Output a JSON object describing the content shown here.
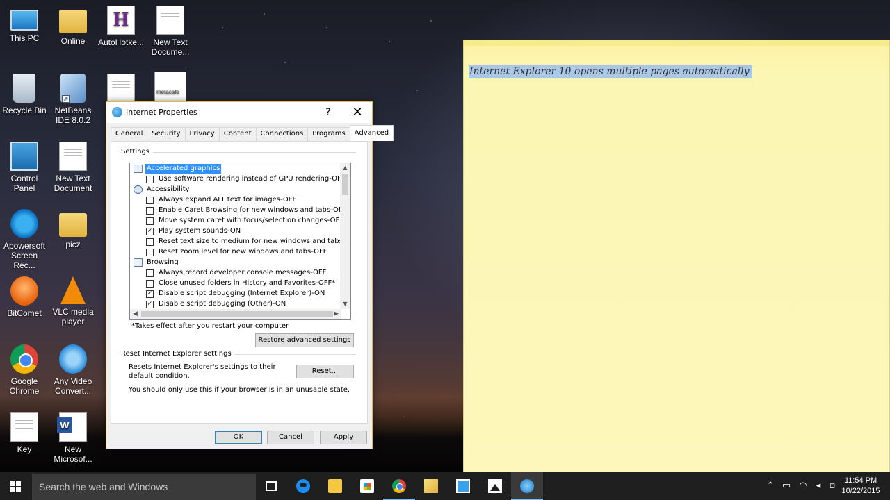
{
  "desktop": {
    "icons": [
      {
        "label": "This PC"
      },
      {
        "label": "Online"
      },
      {
        "label": "AutoHotke..."
      },
      {
        "label": "New Text Docume..."
      },
      {
        "label": "Recycle Bin"
      },
      {
        "label": "NetBeans IDE 8.0.2"
      },
      {
        "label": "Control Panel"
      },
      {
        "label": "New Text Document"
      },
      {
        "label": "Apowersoft Screen Rec..."
      },
      {
        "label": "picz"
      },
      {
        "label": "BitComet"
      },
      {
        "label": "VLC media player"
      },
      {
        "label": "Google Chrome"
      },
      {
        "label": "Any Video Convert..."
      },
      {
        "label": "Key"
      },
      {
        "label": "New Microsof..."
      }
    ],
    "partial_icon_text": "metacafe"
  },
  "sticky_note": {
    "text": "Internet Explorer 10 opens multiple pages automatically"
  },
  "dialog": {
    "title": "Internet Properties",
    "help_label": "?",
    "close_label": "✕",
    "tabs": [
      "General",
      "Security",
      "Privacy",
      "Content",
      "Connections",
      "Programs",
      "Advanced"
    ],
    "active_tab": "Advanced",
    "settings_label": "Settings",
    "tree": [
      {
        "type": "category",
        "text": "Accelerated graphics",
        "selected": true
      },
      {
        "type": "option",
        "text": "Use software rendering instead of GPU rendering-OFF*",
        "checked": false
      },
      {
        "type": "category",
        "text": "Accessibility",
        "selected": false
      },
      {
        "type": "option",
        "text": "Always expand ALT text for images-OFF",
        "checked": false
      },
      {
        "type": "option",
        "text": "Enable Caret Browsing for new windows and tabs-OFF",
        "checked": false
      },
      {
        "type": "option",
        "text": "Move system caret with focus/selection changes-OFF",
        "checked": false
      },
      {
        "type": "option",
        "text": "Play system sounds-ON",
        "checked": true
      },
      {
        "type": "option",
        "text": "Reset text size to medium for new windows and tabs-OFF",
        "checked": false
      },
      {
        "type": "option",
        "text": "Reset zoom level for new windows and tabs-OFF",
        "checked": false
      },
      {
        "type": "category",
        "text": "Browsing",
        "selected": false
      },
      {
        "type": "option",
        "text": "Always record developer console messages-OFF",
        "checked": false
      },
      {
        "type": "option",
        "text": "Close unused folders in History and Favorites-OFF*",
        "checked": false
      },
      {
        "type": "option",
        "text": "Disable script debugging (Internet Explorer)-ON",
        "checked": true
      },
      {
        "type": "option",
        "text": "Disable script debugging (Other)-ON",
        "checked": true
      }
    ],
    "restart_note": "*Takes effect after you restart your computer",
    "restore_button": "Restore advanced settings",
    "reset_group_label": "Reset Internet Explorer settings",
    "reset_description": "Resets Internet Explorer's settings to their default condition.",
    "reset_button": "Reset...",
    "reset_warning": "You should only use this if your browser is in an unusable state.",
    "ok_button": "OK",
    "cancel_button": "Cancel",
    "apply_button": "Apply"
  },
  "taskbar": {
    "search_placeholder": "Search the web and Windows",
    "time": "11:54 PM",
    "date": "10/22/2015"
  }
}
